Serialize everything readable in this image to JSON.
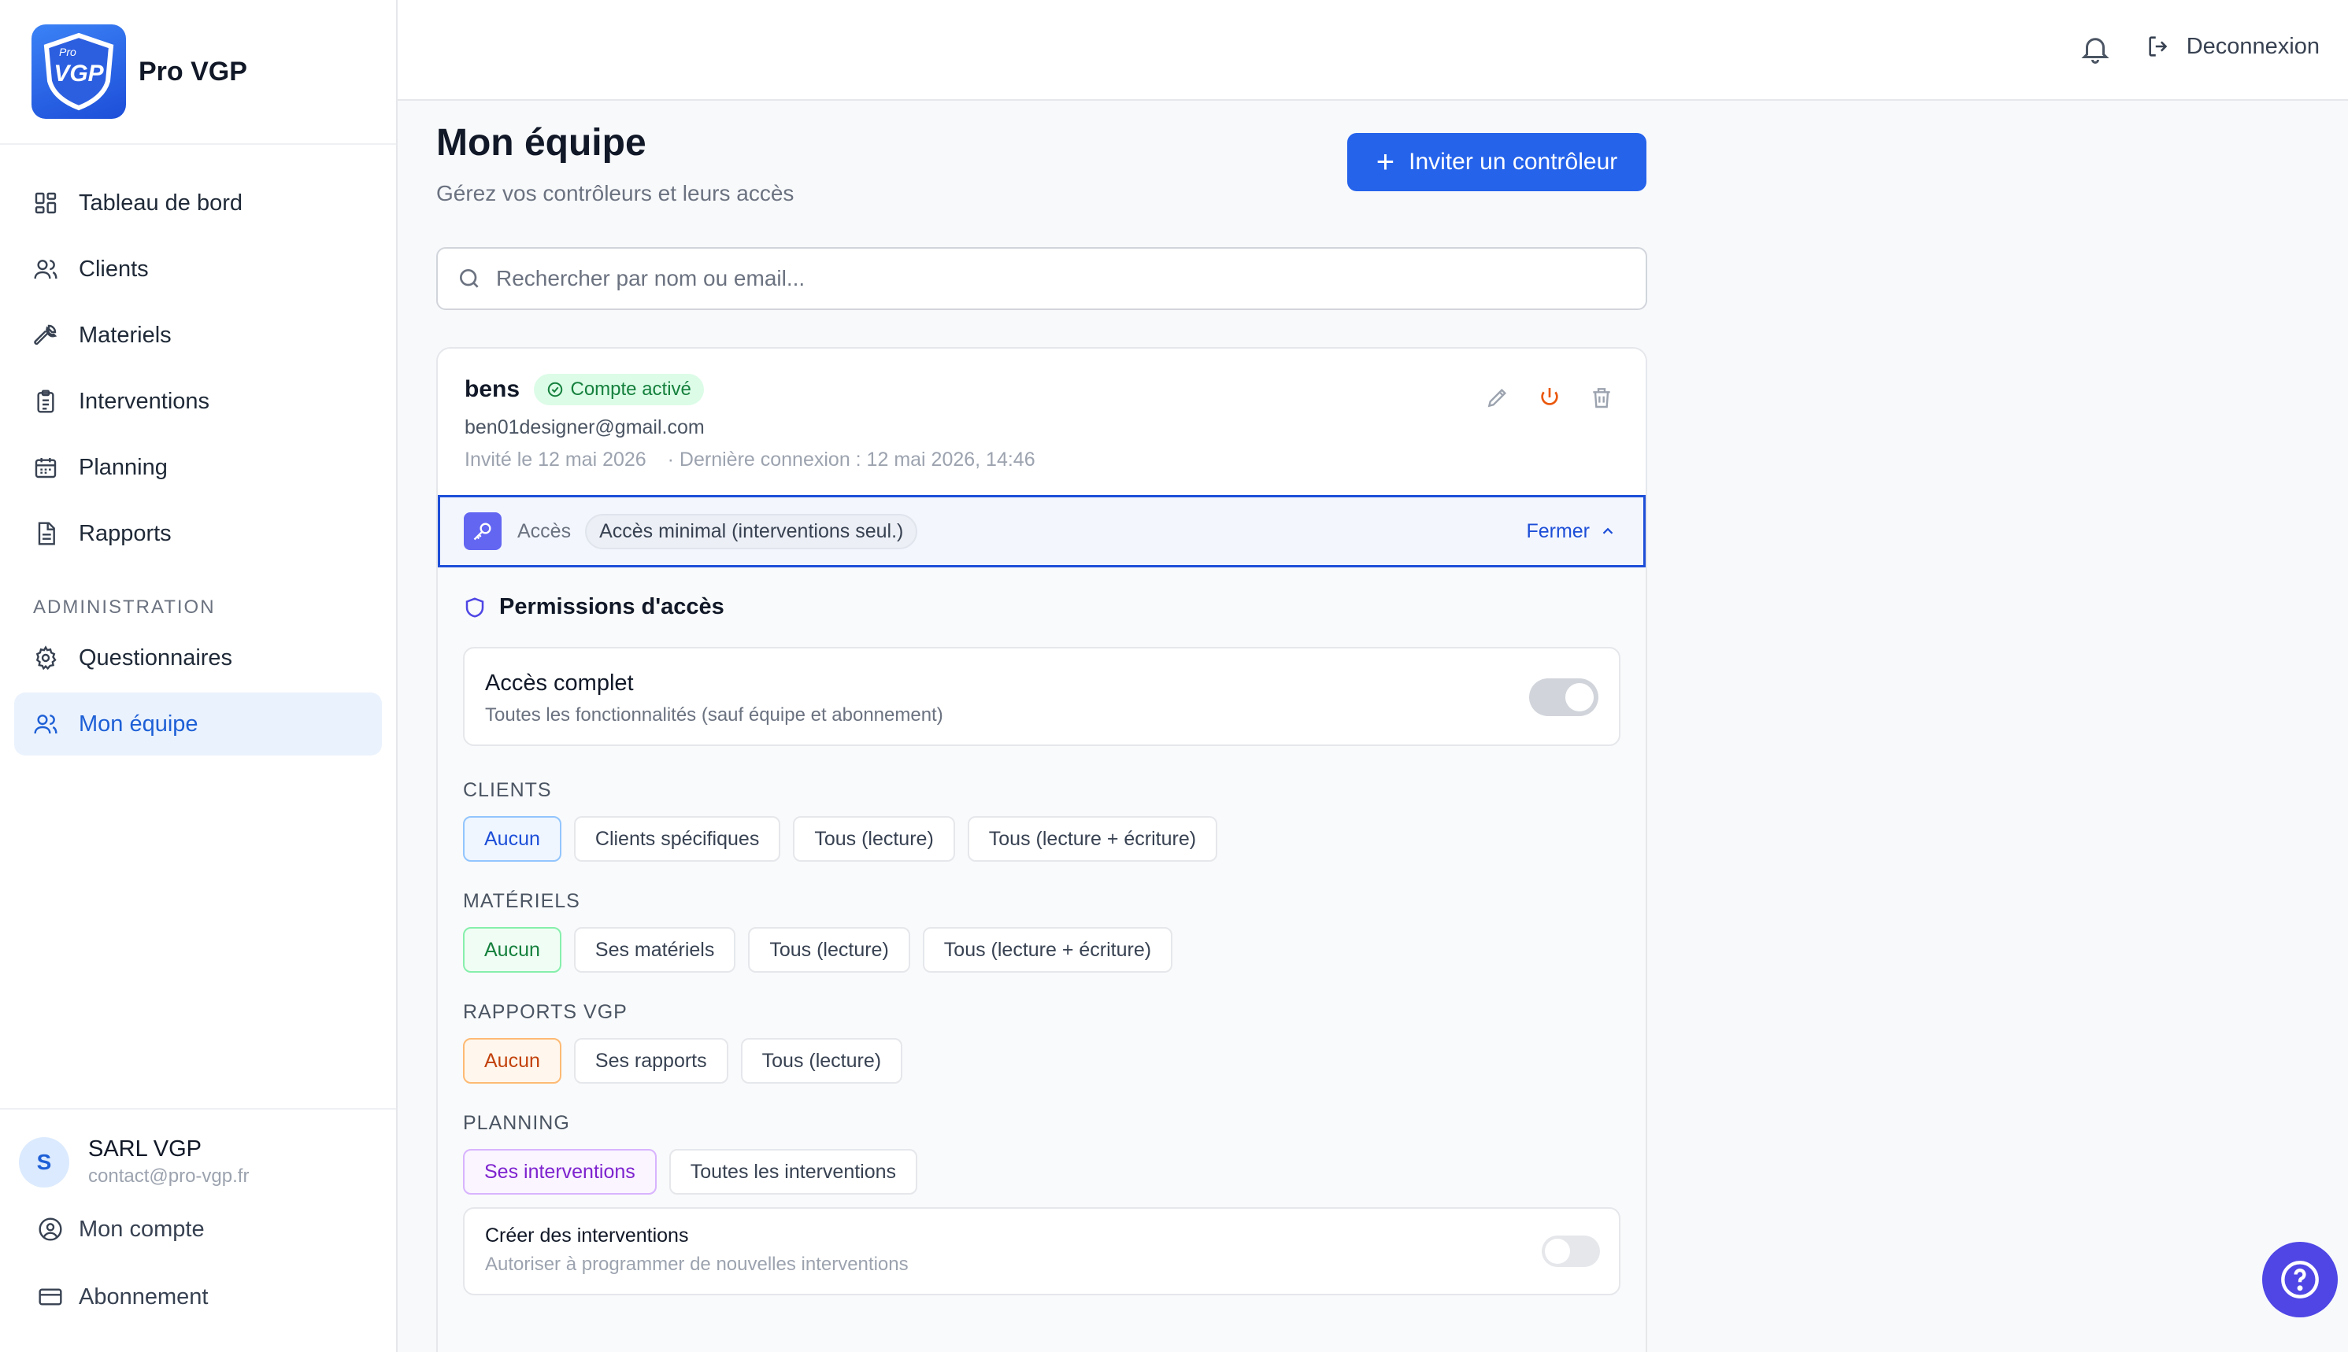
{
  "app": {
    "name": "Pro VGP",
    "logo_text": "VGP",
    "logo_small": "Pro"
  },
  "sidebar": {
    "items": [
      {
        "label": "Tableau de bord",
        "icon": "dashboard-icon"
      },
      {
        "label": "Clients",
        "icon": "users-icon"
      },
      {
        "label": "Materiels",
        "icon": "wrench-icon"
      },
      {
        "label": "Interventions",
        "icon": "clipboard-icon"
      },
      {
        "label": "Planning",
        "icon": "calendar-icon"
      },
      {
        "label": "Rapports",
        "icon": "document-icon"
      }
    ],
    "section_label": "ADMINISTRATION",
    "admin_items": [
      {
        "label": "Questionnaires",
        "icon": "gear-icon"
      },
      {
        "label": "Mon équipe",
        "icon": "users-icon",
        "active": true
      }
    ],
    "user": {
      "initial": "S",
      "name": "SARL VGP",
      "email": "contact@pro-vgp.fr"
    },
    "footer_links": [
      {
        "label": "Mon compte",
        "icon": "user-circle-icon"
      },
      {
        "label": "Abonnement",
        "icon": "credit-card-icon"
      }
    ]
  },
  "topbar": {
    "logout_label": "Deconnexion"
  },
  "page": {
    "title": "Mon équipe",
    "subtitle": "Gérez vos contrôleurs et leurs accès",
    "invite_label": "Inviter un contrôleur",
    "search_placeholder": "Rechercher par nom ou email..."
  },
  "member": {
    "name": "bens",
    "status": "Compte activé",
    "email": "ben01designer@gmail.com",
    "invited": "Invité le 12 mai 2026",
    "last_login": "· Dernière connexion : 12 mai 2026, 14:46",
    "access_label": "Accès",
    "access_value": "Accès minimal (interventions seul.)",
    "close_label": "Fermer"
  },
  "permissions": {
    "title": "Permissions d'accès",
    "full_access": {
      "title": "Accès complet",
      "subtitle": "Toutes les fonctionnalités (sauf équipe et abonnement)",
      "enabled": false
    },
    "groups": [
      {
        "label": "CLIENTS",
        "options": [
          "Aucun",
          "Clients spécifiques",
          "Tous (lecture)",
          "Tous (lecture + écriture)"
        ],
        "selected": "Aucun"
      },
      {
        "label": "MATÉRIELS",
        "options": [
          "Aucun",
          "Ses matériels",
          "Tous (lecture)",
          "Tous (lecture + écriture)"
        ],
        "selected": "Aucun"
      },
      {
        "label": "RAPPORTS VGP",
        "options": [
          "Aucun",
          "Ses rapports",
          "Tous (lecture)"
        ],
        "selected": "Aucun"
      },
      {
        "label": "PLANNING",
        "options": [
          "Ses interventions",
          "Toutes les interventions"
        ],
        "selected": "Ses interventions"
      }
    ],
    "create_interventions": {
      "title": "Créer des interventions",
      "subtitle": "Autoriser à programmer de nouvelles interventions",
      "enabled": false
    }
  },
  "colors": {
    "primary": "#2563eb",
    "active_bg": "#eaf2fd",
    "success": "#15803d",
    "help": "#4f46e5"
  }
}
